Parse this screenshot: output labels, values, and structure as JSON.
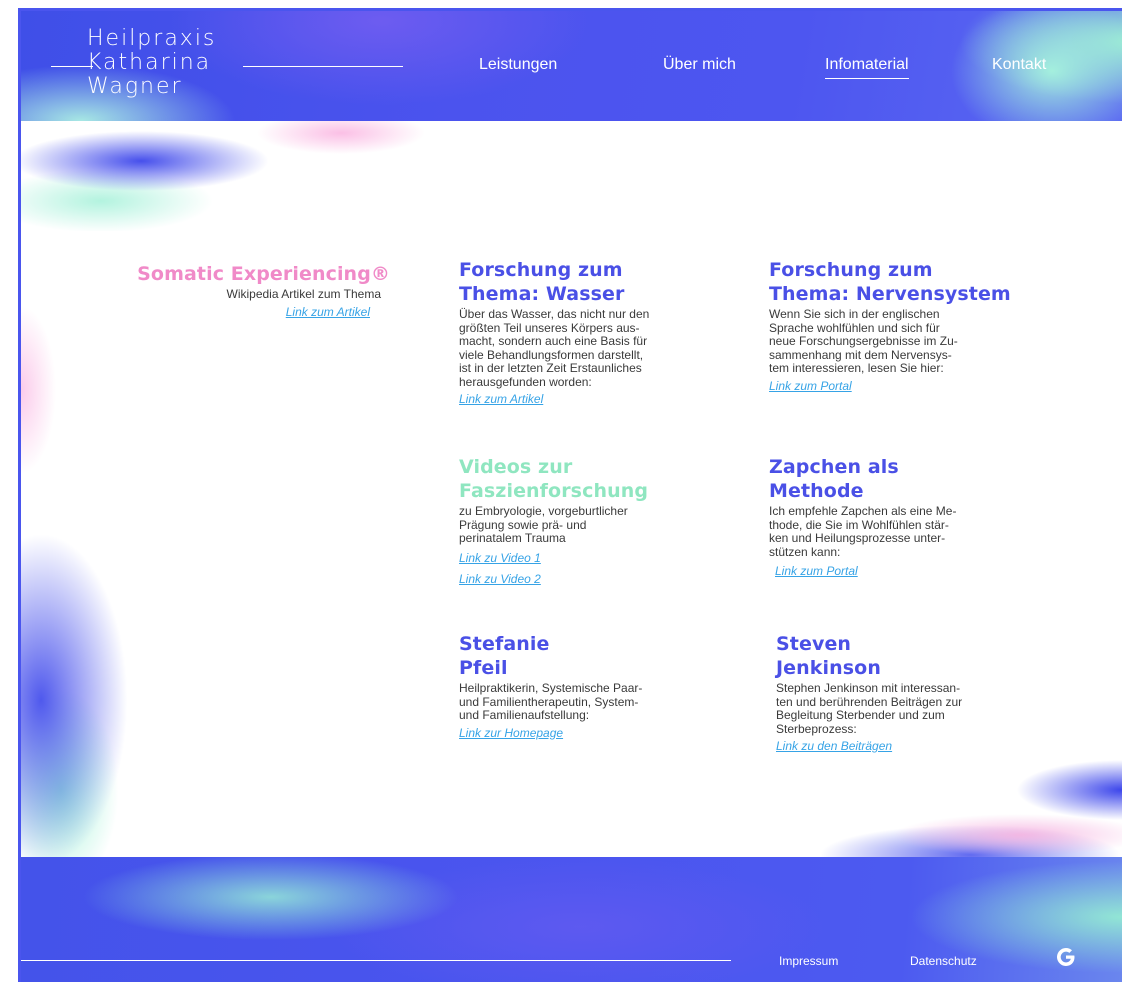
{
  "brand": {
    "lines": [
      "Heilpraxis",
      "Katharina",
      "Wagner"
    ]
  },
  "nav": {
    "items": [
      {
        "label": "Leistungen",
        "active": false
      },
      {
        "label": "Über mich",
        "active": false
      },
      {
        "label": "Infomaterial",
        "active": true
      },
      {
        "label": "Kontakt",
        "active": false
      }
    ]
  },
  "content": {
    "somatic": {
      "title": "Somatic Experiencing®",
      "text": "Wikipedia  Artikel zum Thema",
      "link": "Link zum Artikel"
    },
    "wasser": {
      "title": "Forschung zum\nThema: Wasser",
      "text": "Über das Wasser, das nicht nur den\ngrößten Teil unseres Körpers aus-\nmacht, sondern auch eine Basis für\nviele Behandlungsformen darstellt,\nist in der letzten Zeit Erstaunliches\nherausgefunden worden:",
      "link": "Link zum Artikel"
    },
    "nervensystem": {
      "title": "Forschung zum\nThema: Nervensystem",
      "text": "Wenn Sie sich in der englischen\nSprache wohlfühlen und sich für\nneue Forschungsergebnisse im Zu-\nsammenhang mit dem Nervensys-\ntem interessieren, lesen Sie hier:",
      "link": "Link zum Portal"
    },
    "faszien": {
      "title": "Videos zur\nFaszienforschung",
      "text": "zu Embryologie, vorgeburtlicher\nPrägung sowie prä- und\nperinatalem Trauma",
      "link1": "Link zu Video 1",
      "link2": "Link zu Video 2"
    },
    "zapchen": {
      "title": "Zapchen als\nMethode",
      "text": "Ich empfehle Zapchen als eine Me-\nthode, die Sie im Wohlfühlen stär-\nken und Heilungsprozesse unter-\nstützen kann:",
      "link": "Link zum Portal"
    },
    "pfeil": {
      "title": "Stefanie\nPfeil",
      "text": "Heilpraktikerin, Systemische Paar-\nund Familientherapeutin, System-\nund Familienaufstellung:",
      "link": "Link zur Homepage"
    },
    "jenkinson": {
      "title": "Steven\nJenkinson",
      "text": "Stephen Jenkinson mit interessan-\nten und berührenden Beiträgen zur\nBegleitung Sterbender und zum\nSterbeprozess:",
      "link": "Link zu den Beiträgen"
    }
  },
  "footer": {
    "impressum": "Impressum",
    "datenschutz": "Datenschutz",
    "icon": "google-icon"
  },
  "colors": {
    "primary": "#4a50e6",
    "pink": "#f08ac8",
    "mint": "#8fe6c0",
    "link": "#36a3e6"
  }
}
